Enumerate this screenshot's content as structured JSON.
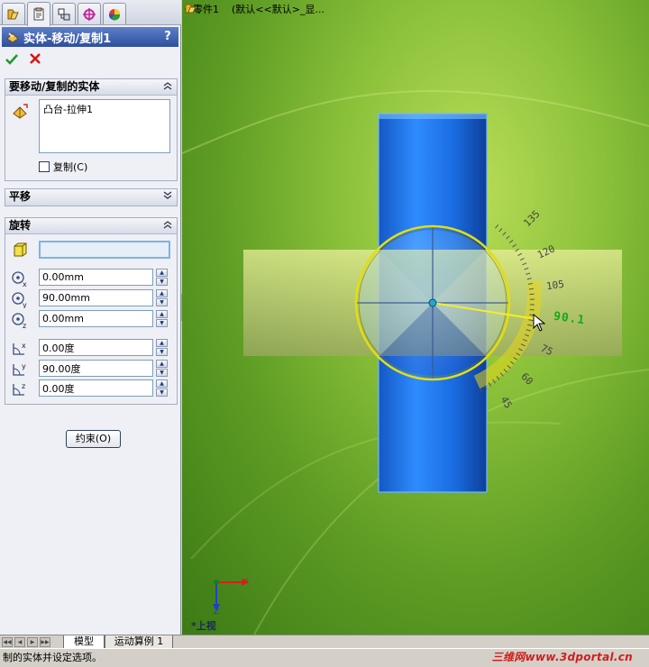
{
  "property_manager": {
    "tabs": [
      "feature-manager",
      "property-manager",
      "configuration-manager",
      "dimxpert-manager",
      "display-manager"
    ],
    "title": "实体-移动/复制1",
    "help": "?",
    "bodies_group": {
      "title": "要移动/复制的实体",
      "items": [
        "凸台-拉伸1"
      ],
      "copy_label": "复制(C)"
    },
    "translate_group": {
      "title": "平移"
    },
    "rotate_group": {
      "title": "旋转",
      "x_origin": "0.00mm",
      "y_origin": "90.00mm",
      "z_origin": "0.00mm",
      "x_angle": "0.00度",
      "y_angle": "90.00度",
      "z_angle": "0.00度"
    },
    "constraint_button": "约束(O)"
  },
  "viewport": {
    "tree_part": "零件1",
    "tree_config": "(默认<<默认>_显...",
    "view_name": "*上视",
    "triad": {
      "x": "X",
      "z": "Z"
    },
    "ruler": {
      "current_angle": "90.1",
      "ticks": [
        "135",
        "120",
        "105",
        "75",
        "60",
        "45"
      ]
    }
  },
  "bottom_tabs": [
    "模型",
    "运动算例 1"
  ],
  "status_text": "制的实体并设定选项。",
  "watermark": "三维网www.3dportal.cn",
  "colors": {
    "accent": "#2e4f9e",
    "viewport_bg": "#8bc13a",
    "cylinder": "#1e6fe0",
    "ring": "#e3dd12"
  }
}
